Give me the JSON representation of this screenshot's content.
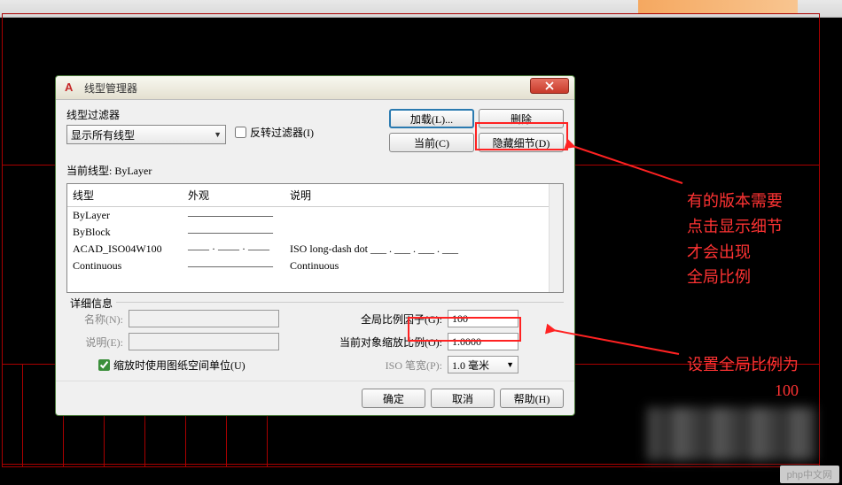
{
  "dialog": {
    "title": "线型管理器",
    "filter": {
      "label": "线型过滤器",
      "selected": "显示所有线型",
      "invert_label": "反转过滤器(I)"
    },
    "buttons": {
      "load": "加载(L)...",
      "delete": "删除",
      "current": "当前(C)",
      "hide_detail": "隐藏细节(D)"
    },
    "current_linetype_label": "当前线型:",
    "current_linetype_value": "ByLayer",
    "table": {
      "headers": [
        "线型",
        "外观",
        "说明"
      ],
      "rows": [
        {
          "name": "ByLayer",
          "appearance": "————————",
          "desc": ""
        },
        {
          "name": "ByBlock",
          "appearance": "————————",
          "desc": ""
        },
        {
          "name": "ACAD_ISO04W100",
          "appearance": "—— · —— · ——",
          "desc": "ISO long-dash dot ___ . ___ . ___ . ___"
        },
        {
          "name": "Continuous",
          "appearance": "————————",
          "desc": "Continuous"
        }
      ]
    },
    "detail": {
      "section_title": "详细信息",
      "name_label": "名称(N):",
      "name_value": "",
      "desc_label": "说明(E):",
      "desc_value": "",
      "global_label": "全局比例因子(G):",
      "global_value": "100",
      "object_label": "当前对象缩放比例(O):",
      "object_value": "1.0000",
      "iso_label": "ISO 笔宽(P):",
      "iso_value": "1.0 毫米",
      "paper_check": "缩放时使用图纸空间单位(U)"
    },
    "footer": {
      "ok": "确定",
      "cancel": "取消",
      "help": "帮助(H)"
    }
  },
  "annotations": {
    "top": "有的版本需要\n点击显示细节\n才会出现\n全局比例",
    "bottom": "设置全局比例为\n100"
  },
  "watermark": "php中文网"
}
